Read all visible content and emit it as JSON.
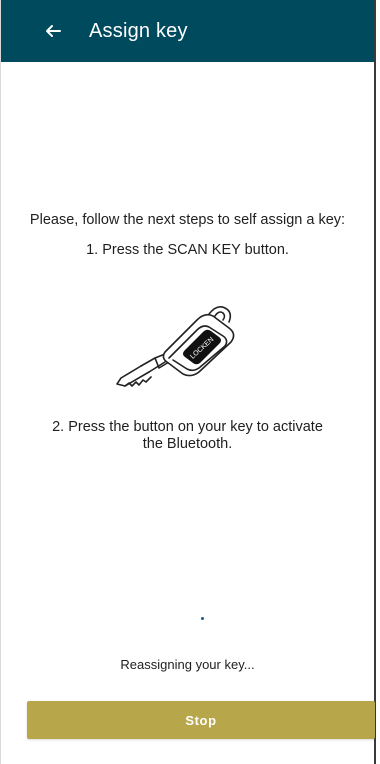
{
  "appbar": {
    "title": "Assign key",
    "back_icon": "arrow-left-icon",
    "background_color": "#004a5e"
  },
  "content": {
    "intro": "Please, follow the next steps to self assign a key:",
    "step1": "1. Press the SCAN KEY button.",
    "key_image_label": "LOCKEN",
    "step2": "2. Press the button on your key to activate the Bluetooth."
  },
  "status": {
    "text": "Reassigning your key..."
  },
  "actions": {
    "stop_label": "Stop",
    "stop_color": "#b8a64a"
  }
}
